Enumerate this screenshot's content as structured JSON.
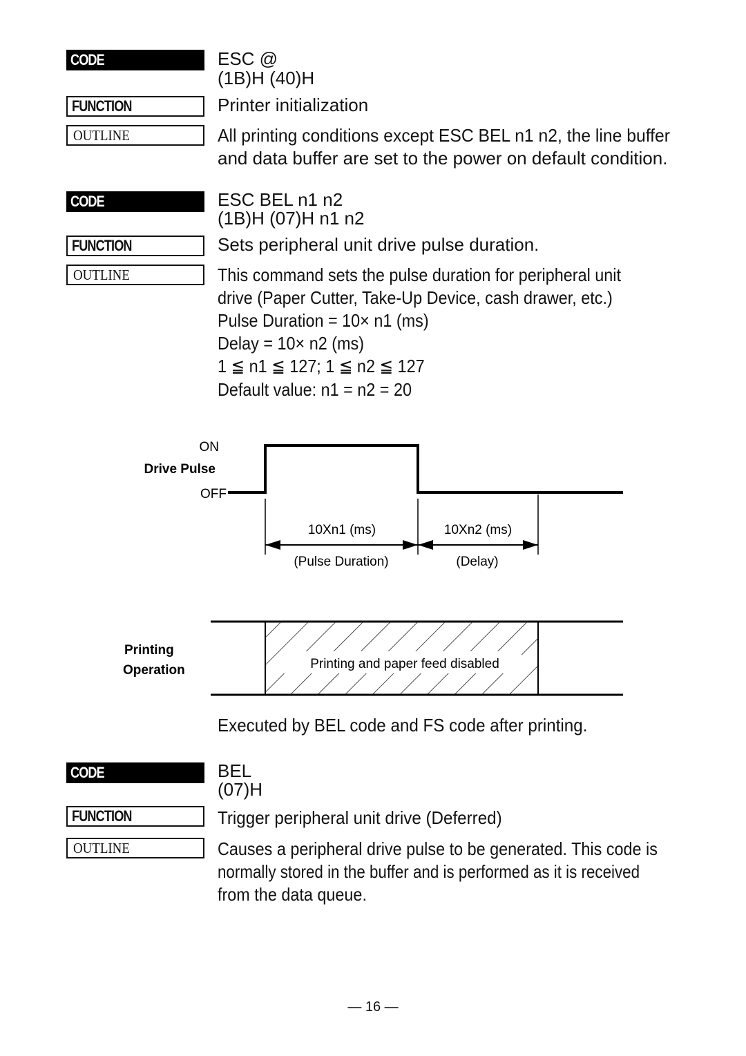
{
  "labels": {
    "code": "CODE",
    "function": "FUNCTION",
    "outline": "OUTLINE"
  },
  "sections": [
    {
      "code_line1": "ESC @",
      "code_line2": "(1B)H (40)H",
      "function": "Printer initialization",
      "outline": [
        "All printing conditions except ESC BEL n1 n2, the line buffer",
        "and data buffer are set to the power on default condition."
      ]
    },
    {
      "code_line1": "ESC BEL n1 n2",
      "code_line2": "(1B)H (07)H n1 n2",
      "function": "Sets peripheral unit drive pulse duration.",
      "outline": [
        "This command sets the pulse duration for peripheral unit",
        "drive (Paper Cutter, Take-Up Device, cash drawer, etc.)",
        "Pulse Duration = 10× n1 (ms)",
        "Delay = 10× n2 (ms)",
        "1 ≦ n1 ≦ 127; 1 ≦ n2 ≦ 127",
        "Default value: n1 = n2 = 20"
      ],
      "note": "Executed by BEL code and FS code after printing."
    },
    {
      "code_line1": "BEL",
      "code_line2": "(07)H",
      "function": "Trigger peripheral unit drive (Deferred)",
      "outline": [
        "Causes a peripheral drive pulse to be generated. This code is",
        "normally stored in the buffer and is performed as it is received",
        "from the data queue."
      ]
    }
  ],
  "diagram": {
    "pulse_on": "ON",
    "pulse_title": "Drive Pulse",
    "pulse_off": "OFF",
    "dim1_value": "10Xn1 (ms)",
    "dim1_caption": "(Pulse Duration)",
    "dim2_value": "10Xn2 (ms)",
    "dim2_caption": "(Delay)",
    "printing_title_1": "Printing",
    "printing_title_2": "Operation",
    "disabled_text": "Printing and paper feed disabled"
  },
  "footer": {
    "page_number": "— 16 —"
  }
}
